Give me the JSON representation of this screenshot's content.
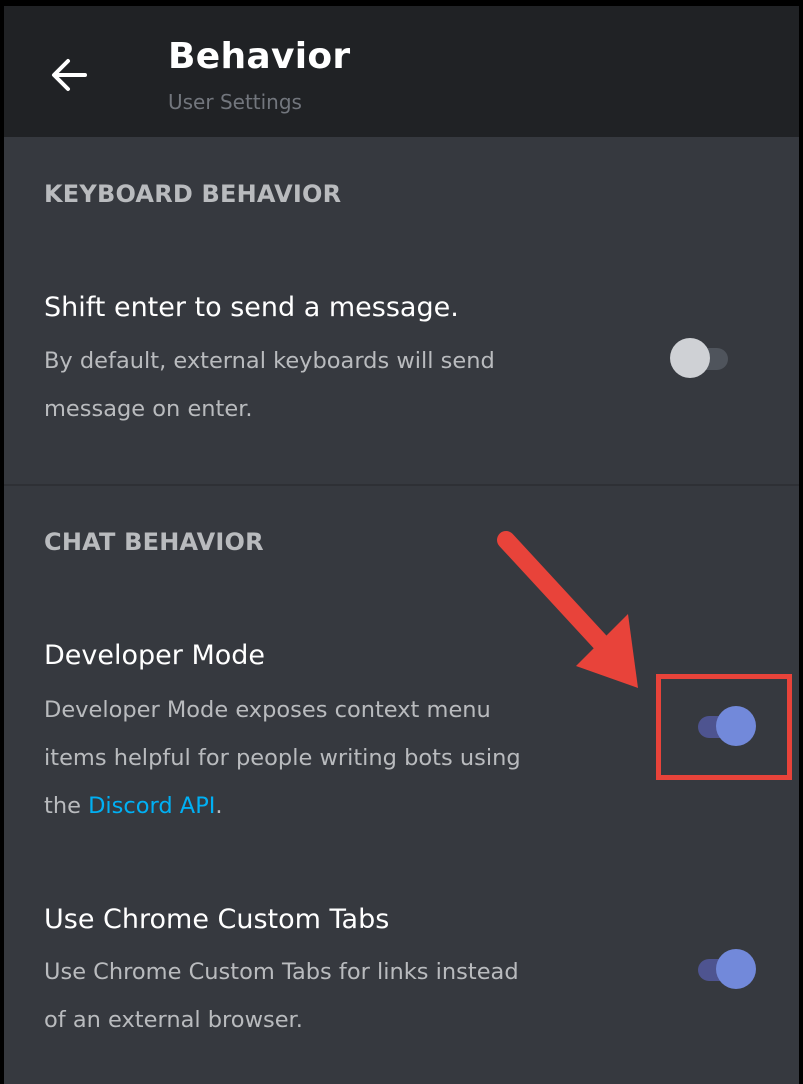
{
  "header": {
    "title": "Behavior",
    "subtitle": "User Settings",
    "back_icon": "arrow-left-icon"
  },
  "sections": [
    {
      "header": "KEYBOARD BEHAVIOR",
      "rows": [
        {
          "title": "Shift enter to send a message.",
          "description_lines": [
            "By default, external keyboards will send",
            "message on enter."
          ],
          "enabled": false
        }
      ]
    },
    {
      "header": "CHAT BEHAVIOR",
      "rows": [
        {
          "title": "Developer Mode",
          "description_lines": [
            "Developer Mode exposes context menu",
            "items helpful for people writing bots using"
          ],
          "description_last_prefix": "the ",
          "description_link": "Discord API",
          "description_last_suffix": ".",
          "enabled": true
        },
        {
          "title": "Use Chrome Custom Tabs",
          "description_lines": [
            "Use Chrome Custom Tabs for links instead",
            "of an external browser."
          ],
          "enabled": true
        }
      ]
    }
  ],
  "annotation": {
    "arrow_color": "#e8433a",
    "box_color": "#e8433a"
  },
  "colors": {
    "background": "#36393f",
    "topbar": "#202225",
    "toggle_on": "#7289da",
    "link": "#00b0f4"
  }
}
